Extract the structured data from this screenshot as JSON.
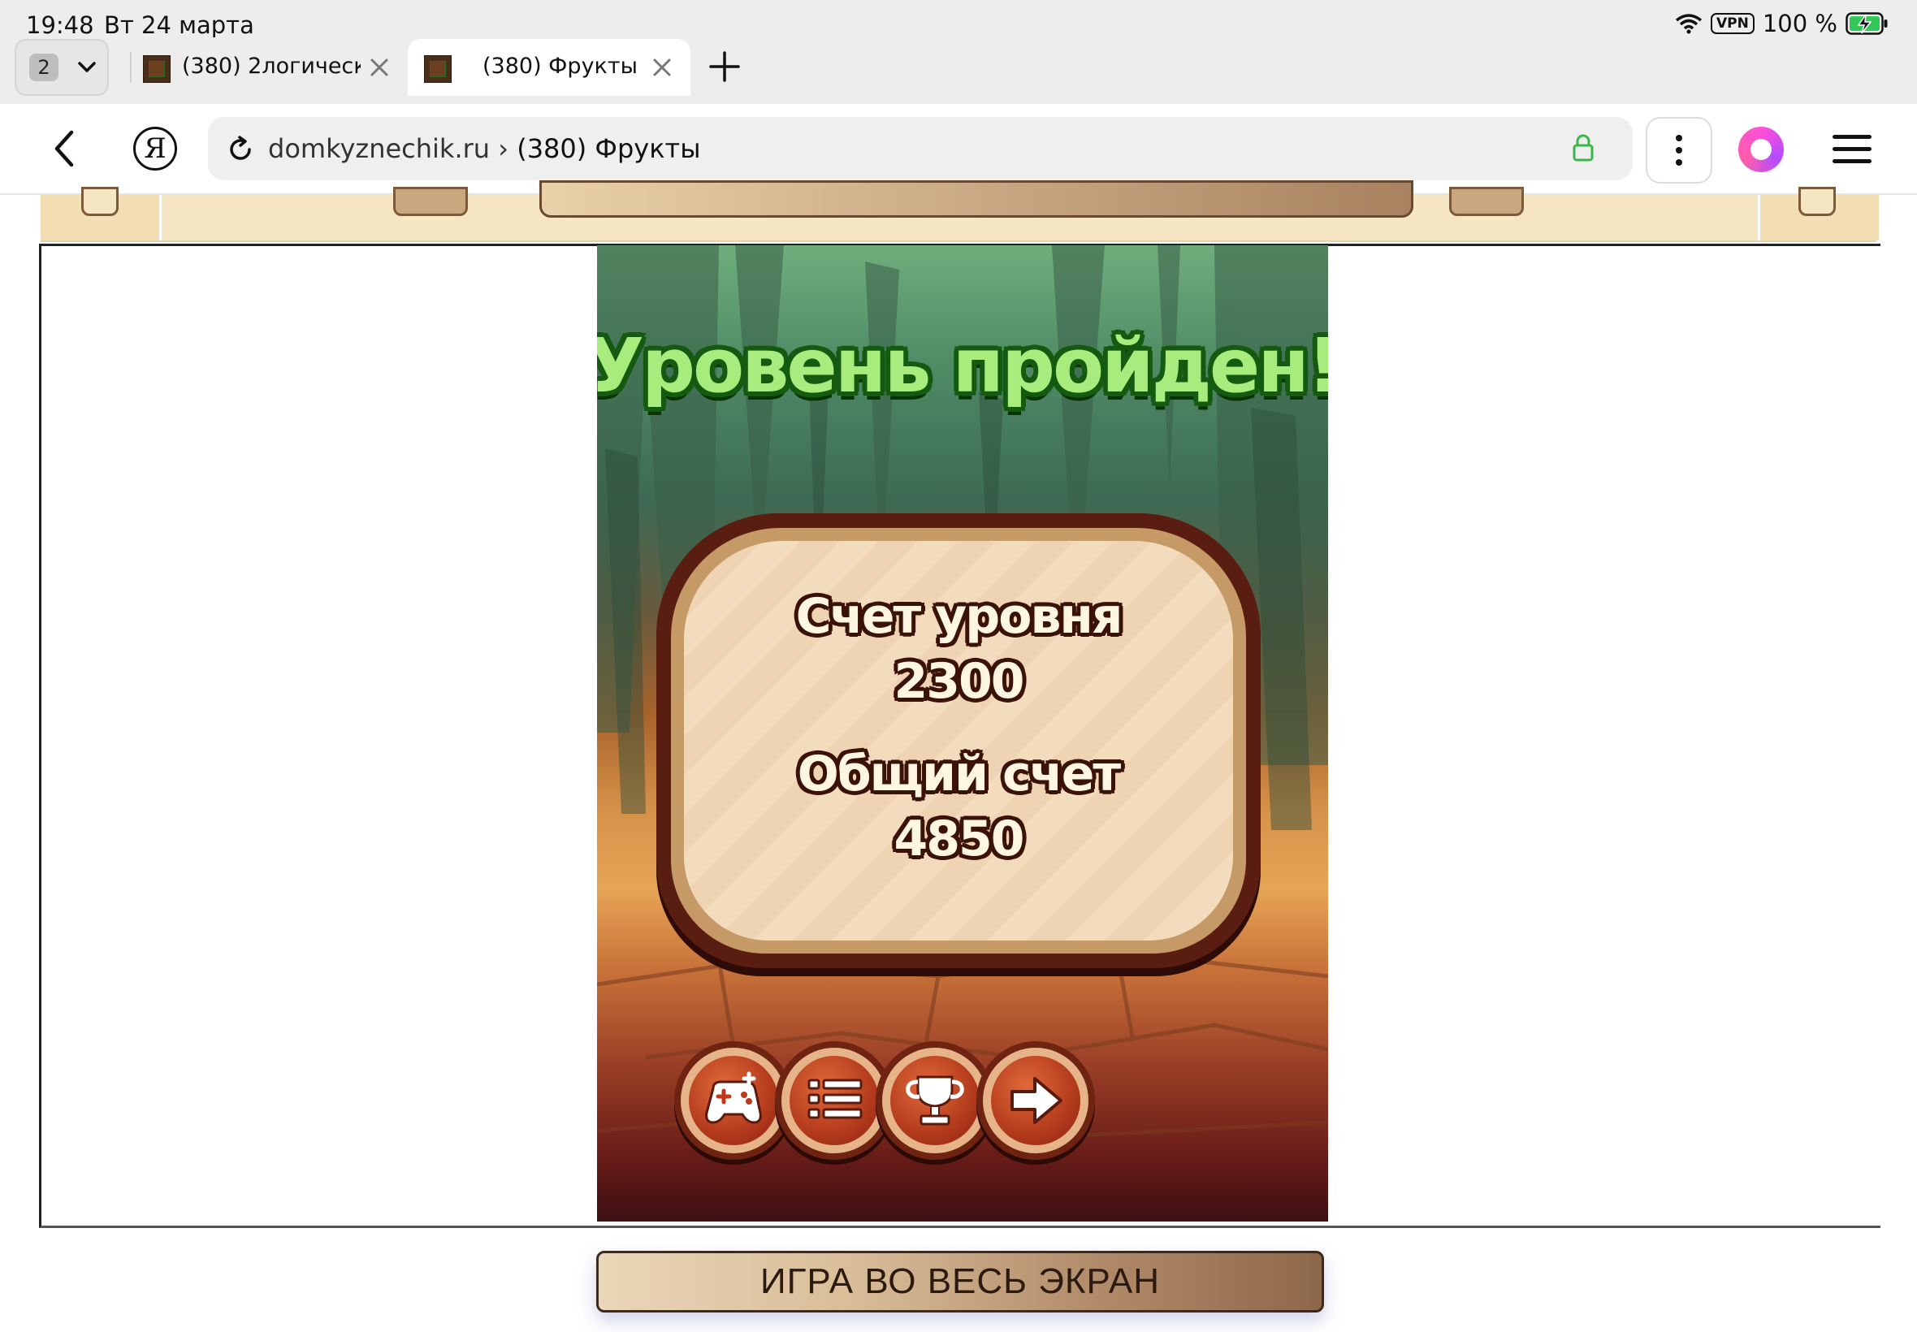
{
  "status_bar": {
    "time": "19:48",
    "date": "Вт 24 марта",
    "vpn": "VPN",
    "battery": "100 %"
  },
  "tabs": {
    "count": "2",
    "items": [
      {
        "title": "(380) 2логическ..."
      },
      {
        "title": "(380) Фрукты"
      }
    ]
  },
  "address_bar": {
    "domain": "domkyznechik.ru",
    "separator": " › ",
    "page": "(380) Фрукты",
    "yandex_logo": "Я"
  },
  "game": {
    "title": "Уровень пройден!",
    "level_score_label": "Счет уровня",
    "level_score": "2300",
    "total_score_label": "Общий счет",
    "total_score": "4850",
    "buttons": [
      "gamepad-icon",
      "list-icon",
      "trophy-icon",
      "arrow-right-icon"
    ]
  },
  "fullscreen_button": "ИГРА ВО ВЕСЬ ЭКРАН",
  "colors": {
    "title_green": "#a8ec7d",
    "title_outline": "#145a10",
    "panel_brown": "#5a1d12",
    "button_red": "#b33a1c"
  }
}
